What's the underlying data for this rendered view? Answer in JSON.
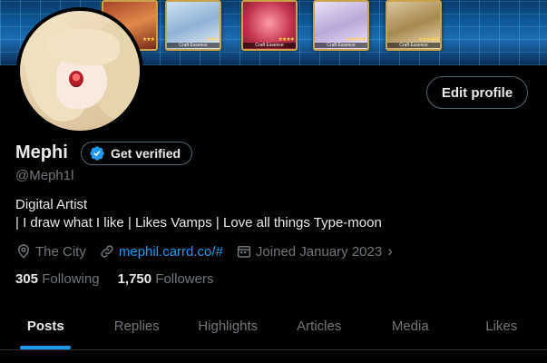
{
  "banner": {
    "cards": [
      {
        "caption": "",
        "stars": "★★★"
      },
      {
        "caption": "Craft Essence",
        "stars": "★★★"
      },
      {
        "caption": "Craft Essence",
        "stars": "★★★★"
      },
      {
        "caption": "Craft Essence",
        "stars": "★★★★★"
      },
      {
        "caption": "Craft Essence",
        "stars": "★★★★★"
      }
    ],
    "colors": {
      "accent": "#1d9bf0",
      "frame": "#c9a24a"
    }
  },
  "profile": {
    "name": "Mephi",
    "verify_label": "Get verified",
    "handle": "@Meph1l",
    "bio_line1": "Digital Artist",
    "bio_line2": "| I draw what I like | Likes Vamps | Love all things Type-moon",
    "location": "The City",
    "website": "mephil.carrd.co/#",
    "joined": "Joined January 2023",
    "following_count": "305",
    "following_label": "Following",
    "followers_count": "1,750",
    "followers_label": "Followers",
    "edit_label": "Edit profile"
  },
  "tabs": [
    {
      "label": "Posts",
      "active": true
    },
    {
      "label": "Replies",
      "active": false
    },
    {
      "label": "Highlights",
      "active": false
    },
    {
      "label": "Articles",
      "active": false
    },
    {
      "label": "Media",
      "active": false
    },
    {
      "label": "Likes",
      "active": false
    }
  ],
  "icons": {
    "location": "location-pin-icon",
    "link": "link-icon",
    "calendar": "calendar-icon",
    "verified": "verified-badge-icon"
  }
}
